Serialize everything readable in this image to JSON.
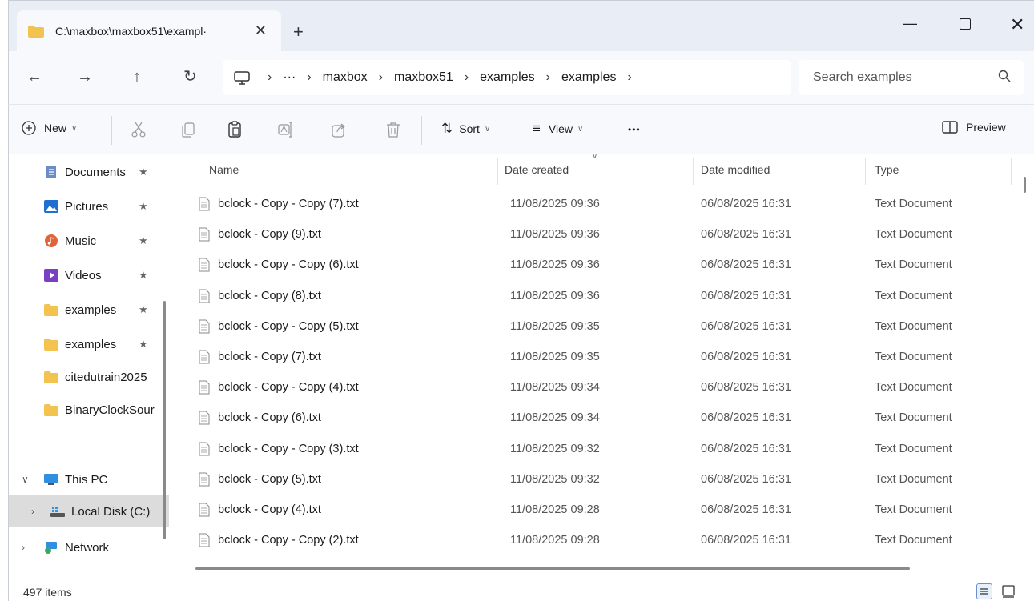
{
  "window": {
    "tab_title": "C:\\maxbox\\maxbox51\\exampl·",
    "tab_close": "✕",
    "new_tab": "+",
    "min": "—",
    "close": "✕"
  },
  "nav": {
    "back": "←",
    "forward": "→",
    "up": "↑",
    "refresh": "↻"
  },
  "address": {
    "ellipsis": "···",
    "sep": "›",
    "crumbs": [
      "maxbox",
      "maxbox51",
      "examples",
      "examples"
    ]
  },
  "search": {
    "placeholder": "Search examples"
  },
  "toolbar": {
    "new_label": "New",
    "sort_label": "Sort",
    "view_label": "View",
    "more": "•••",
    "preview_label": "Preview"
  },
  "sidebar": {
    "items": [
      {
        "label": "Documents",
        "icon": "documents-icon",
        "pinned": true
      },
      {
        "label": "Pictures",
        "icon": "pictures-icon",
        "pinned": true
      },
      {
        "label": "Music",
        "icon": "music-icon",
        "pinned": true
      },
      {
        "label": "Videos",
        "icon": "videos-icon",
        "pinned": true
      },
      {
        "label": "examples",
        "icon": "folder-icon",
        "pinned": true
      },
      {
        "label": "examples",
        "icon": "folder-icon",
        "pinned": true
      },
      {
        "label": "citedutrain2025",
        "icon": "folder-icon",
        "pinned": false
      },
      {
        "label": "BinaryClockSour",
        "icon": "folder-icon",
        "pinned": false
      }
    ],
    "pin_glyph": "★",
    "this_pc": "This PC",
    "local_disk": "Local Disk (C:)",
    "network": "Network",
    "expanded_glyph": "∨",
    "collapsed_glyph": "›"
  },
  "columns": {
    "name": "Name",
    "created": "Date created",
    "modified": "Date modified",
    "type": "Type",
    "sort_caret": "∨"
  },
  "files": [
    {
      "name": "bclock - Copy - Copy (7).txt",
      "created": "11/08/2025 09:36",
      "modified": "06/08/2025 16:31",
      "type": "Text Document"
    },
    {
      "name": "bclock - Copy (9).txt",
      "created": "11/08/2025 09:36",
      "modified": "06/08/2025 16:31",
      "type": "Text Document"
    },
    {
      "name": "bclock - Copy - Copy (6).txt",
      "created": "11/08/2025 09:36",
      "modified": "06/08/2025 16:31",
      "type": "Text Document"
    },
    {
      "name": "bclock - Copy (8).txt",
      "created": "11/08/2025 09:36",
      "modified": "06/08/2025 16:31",
      "type": "Text Document"
    },
    {
      "name": "bclock - Copy - Copy (5).txt",
      "created": "11/08/2025 09:35",
      "modified": "06/08/2025 16:31",
      "type": "Text Document"
    },
    {
      "name": "bclock - Copy (7).txt",
      "created": "11/08/2025 09:35",
      "modified": "06/08/2025 16:31",
      "type": "Text Document"
    },
    {
      "name": "bclock - Copy - Copy (4).txt",
      "created": "11/08/2025 09:34",
      "modified": "06/08/2025 16:31",
      "type": "Text Document"
    },
    {
      "name": "bclock - Copy (6).txt",
      "created": "11/08/2025 09:34",
      "modified": "06/08/2025 16:31",
      "type": "Text Document"
    },
    {
      "name": "bclock - Copy - Copy (3).txt",
      "created": "11/08/2025 09:32",
      "modified": "06/08/2025 16:31",
      "type": "Text Document"
    },
    {
      "name": "bclock - Copy (5).txt",
      "created": "11/08/2025 09:32",
      "modified": "06/08/2025 16:31",
      "type": "Text Document"
    },
    {
      "name": "bclock - Copy (4).txt",
      "created": "11/08/2025 09:28",
      "modified": "06/08/2025 16:31",
      "type": "Text Document"
    },
    {
      "name": "bclock - Copy - Copy (2).txt",
      "created": "11/08/2025 09:28",
      "modified": "06/08/2025 16:31",
      "type": "Text Document"
    }
  ],
  "status": {
    "count": "497 items"
  },
  "colors": {
    "folder": "#f2c44f",
    "accent": "#2a6fd6",
    "chrome": "#f7f9fc"
  }
}
